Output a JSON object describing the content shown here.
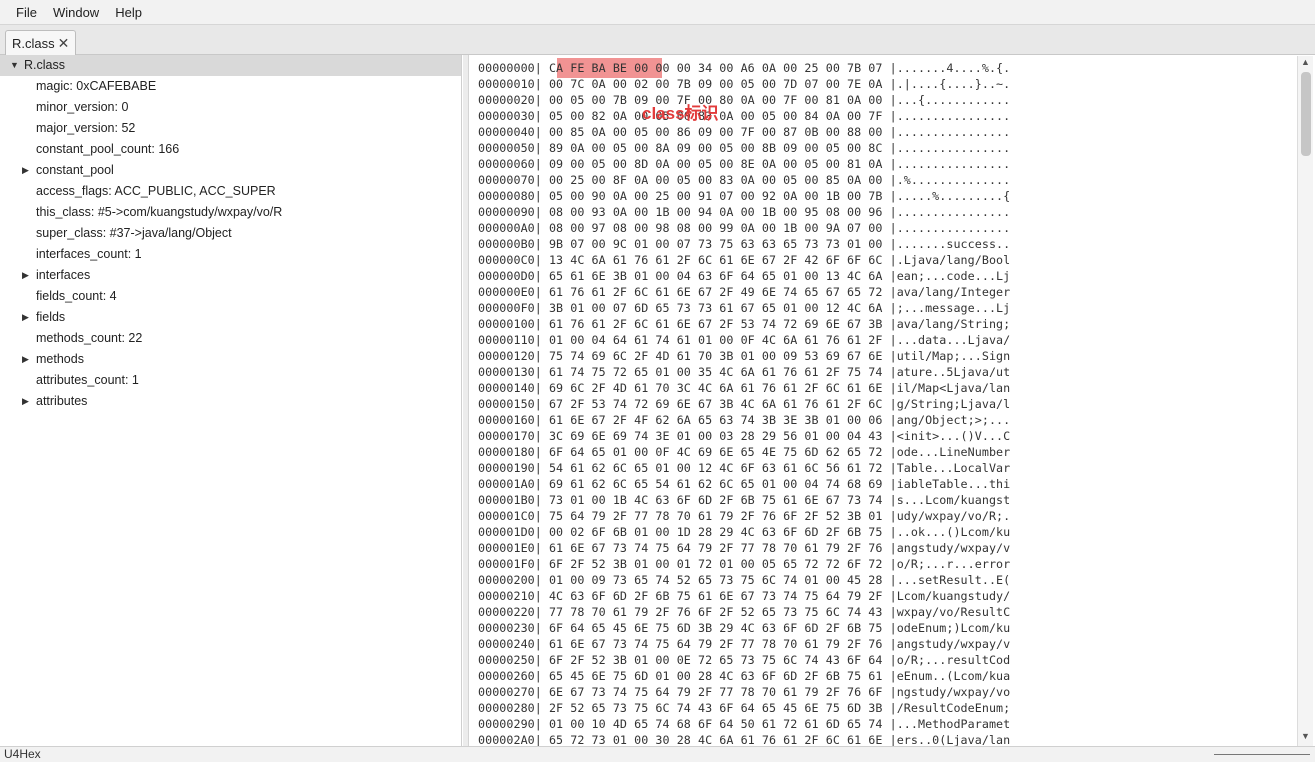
{
  "menu": {
    "file": "File",
    "window": "Window",
    "help": "Help"
  },
  "tab": {
    "label": "R.class",
    "close": "✕"
  },
  "tree": {
    "root": "R.class",
    "items": [
      {
        "label": "magic: 0xCAFEBABE",
        "expandable": false
      },
      {
        "label": "minor_version: 0",
        "expandable": false
      },
      {
        "label": "major_version: 52",
        "expandable": false
      },
      {
        "label": "constant_pool_count: 166",
        "expandable": false
      },
      {
        "label": "constant_pool",
        "expandable": true
      },
      {
        "label": "access_flags: ACC_PUBLIC, ACC_SUPER",
        "expandable": false
      },
      {
        "label": "this_class: #5->com/kuangstudy/wxpay/vo/R",
        "expandable": false
      },
      {
        "label": "super_class: #37->java/lang/Object",
        "expandable": false
      },
      {
        "label": "interfaces_count: 1",
        "expandable": false
      },
      {
        "label": "interfaces",
        "expandable": true
      },
      {
        "label": "fields_count: 4",
        "expandable": false
      },
      {
        "label": "fields",
        "expandable": true
      },
      {
        "label": "methods_count: 22",
        "expandable": false
      },
      {
        "label": "methods",
        "expandable": true
      },
      {
        "label": "attributes_count: 1",
        "expandable": false
      },
      {
        "label": "attributes",
        "expandable": true
      }
    ]
  },
  "hex": {
    "annotation": "class标识",
    "highlight_color": "#f19393",
    "lines": [
      "00000000| CA FE BA BE 00 00 00 34 00 A6 0A 00 25 00 7B 07 |.......4....%.{.",
      "00000010| 00 7C 0A 00 02 00 7B 09 00 05 00 7D 07 00 7E 0A |.|....{....}..~.",
      "00000020| 00 05 00 7B 09 00 7F 00 80 0A 00 7F 00 81 0A 00 |...{............",
      "00000030| 05 00 82 0A 00 05 00 83 0A 00 05 00 84 0A 00 7F |................",
      "00000040| 00 85 0A 00 05 00 86 09 00 7F 00 87 0B 00 88 00 |................",
      "00000050| 89 0A 00 05 00 8A 09 00 05 00 8B 09 00 05 00 8C |................",
      "00000060| 09 00 05 00 8D 0A 00 05 00 8E 0A 00 05 00 81 0A |................",
      "00000070| 00 25 00 8F 0A 00 05 00 83 0A 00 05 00 85 0A 00 |.%..............",
      "00000080| 05 00 90 0A 00 25 00 91 07 00 92 0A 00 1B 00 7B |.....%.........{",
      "00000090| 08 00 93 0A 00 1B 00 94 0A 00 1B 00 95 08 00 96 |................",
      "000000A0| 08 00 97 08 00 98 08 00 99 0A 00 1B 00 9A 07 00 |................",
      "000000B0| 9B 07 00 9C 01 00 07 73 75 63 63 65 73 73 01 00 |.......success..",
      "000000C0| 13 4C 6A 61 76 61 2F 6C 61 6E 67 2F 42 6F 6F 6C |.Ljava/lang/Bool",
      "000000D0| 65 61 6E 3B 01 00 04 63 6F 64 65 01 00 13 4C 6A |ean;...code...Lj",
      "000000E0| 61 76 61 2F 6C 61 6E 67 2F 49 6E 74 65 67 65 72 |ava/lang/Integer",
      "000000F0| 3B 01 00 07 6D 65 73 73 61 67 65 01 00 12 4C 6A |;...message...Lj",
      "00000100| 61 76 61 2F 6C 61 6E 67 2F 53 74 72 69 6E 67 3B |ava/lang/String;",
      "00000110| 01 00 04 64 61 74 61 01 00 0F 4C 6A 61 76 61 2F |...data...Ljava/",
      "00000120| 75 74 69 6C 2F 4D 61 70 3B 01 00 09 53 69 67 6E |util/Map;...Sign",
      "00000130| 61 74 75 72 65 01 00 35 4C 6A 61 76 61 2F 75 74 |ature..5Ljava/ut",
      "00000140| 69 6C 2F 4D 61 70 3C 4C 6A 61 76 61 2F 6C 61 6E |il/Map<Ljava/lan",
      "00000150| 67 2F 53 74 72 69 6E 67 3B 4C 6A 61 76 61 2F 6C |g/String;Ljava/l",
      "00000160| 61 6E 67 2F 4F 62 6A 65 63 74 3B 3E 3B 01 00 06 |ang/Object;>;...",
      "00000170| 3C 69 6E 69 74 3E 01 00 03 28 29 56 01 00 04 43 |<init>...()V...C",
      "00000180| 6F 64 65 01 00 0F 4C 69 6E 65 4E 75 6D 62 65 72 |ode...LineNumber",
      "00000190| 54 61 62 6C 65 01 00 12 4C 6F 63 61 6C 56 61 72 |Table...LocalVar",
      "000001A0| 69 61 62 6C 65 54 61 62 6C 65 01 00 04 74 68 69 |iableTable...thi",
      "000001B0| 73 01 00 1B 4C 63 6F 6D 2F 6B 75 61 6E 67 73 74 |s...Lcom/kuangst",
      "000001C0| 75 64 79 2F 77 78 70 61 79 2F 76 6F 2F 52 3B 01 |udy/wxpay/vo/R;.",
      "000001D0| 00 02 6F 6B 01 00 1D 28 29 4C 63 6F 6D 2F 6B 75 |..ok...()Lcom/ku",
      "000001E0| 61 6E 67 73 74 75 64 79 2F 77 78 70 61 79 2F 76 |angstudy/wxpay/v",
      "000001F0| 6F 2F 52 3B 01 00 01 72 01 00 05 65 72 72 6F 72 |o/R;...r...error",
      "00000200| 01 00 09 73 65 74 52 65 73 75 6C 74 01 00 45 28 |...setResult..E(",
      "00000210| 4C 63 6F 6D 2F 6B 75 61 6E 67 73 74 75 64 79 2F |Lcom/kuangstudy/",
      "00000220| 77 78 70 61 79 2F 76 6F 2F 52 65 73 75 6C 74 43 |wxpay/vo/ResultC",
      "00000230| 6F 64 65 45 6E 75 6D 3B 29 4C 63 6F 6D 2F 6B 75 |odeEnum;)Lcom/ku",
      "00000240| 61 6E 67 73 74 75 64 79 2F 77 78 70 61 79 2F 76 |angstudy/wxpay/v",
      "00000250| 6F 2F 52 3B 01 00 0E 72 65 73 75 6C 74 43 6F 64 |o/R;...resultCod",
      "00000260| 65 45 6E 75 6D 01 00 28 4C 63 6F 6D 2F 6B 75 61 |eEnum..(Lcom/kua",
      "00000270| 6E 67 73 74 75 64 79 2F 77 78 70 61 79 2F 76 6F |ngstudy/wxpay/vo",
      "00000280| 2F 52 65 73 75 6C 74 43 6F 64 65 45 6E 75 6D 3B |/ResultCodeEnum;",
      "00000290| 01 00 10 4D 65 74 68 6F 64 50 61 72 61 6D 65 74 |...MethodParamet",
      "000002A0| 65 72 73 01 00 30 28 4C 6A 61 76 61 2F 6C 61 6E |ers..0(Ljava/lan"
    ]
  },
  "scrollbar": {
    "thumb_fraction": 0.12
  },
  "status": {
    "text": "U4Hex"
  }
}
